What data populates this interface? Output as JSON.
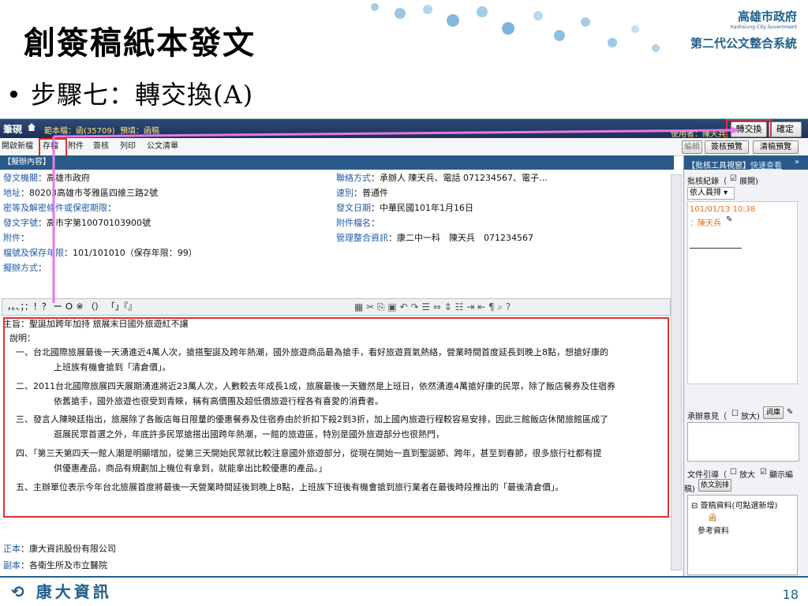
{
  "slide": {
    "title": "創簽稿紙本發文",
    "subtitle": "• 步驟七：轉交換(A)",
    "logo_brand": "高雄市政府",
    "logo_sub": "Kaohsiung City Government",
    "logo_system": "第二代公文整合系統",
    "footer_company": "康大資訊",
    "page_number": "18"
  },
  "app": {
    "topbar": {
      "app_label": "筆硯",
      "doc_no": "範本檔：函(35709)",
      "preset": "預填：函稿",
      "user": "使用者：陳天兵",
      "transfer_button": "轉交換",
      "confirm_button": "確定"
    },
    "toolbar": {
      "items": [
        "開啟新檔",
        "存檔",
        "附件",
        "簽核",
        "列印",
        "公文清單"
      ],
      "edit_button": "編輯",
      "review_preview": "簽核預覽",
      "clean_preview": "清稿預覽"
    },
    "tab_label": "【擬辦內容】",
    "fields_left": [
      {
        "label": "發文機關",
        "value": "：高雄市政府"
      },
      {
        "label": "地址",
        "value": "：80203高雄市苓雅區四維三路2號"
      },
      {
        "label": "密等及解密條件或保密期限",
        "value": "："
      },
      {
        "label": "發文字號",
        "value": "：高市字第10070103900號"
      },
      {
        "label": "附件",
        "value": "："
      },
      {
        "label": "檔號及保存年限",
        "value": "：101/101010（保存年限：99）"
      },
      {
        "label": "擬辦方式",
        "value": "："
      }
    ],
    "fields_right": [
      {
        "label": "聯絡方式",
        "value": "：承辦人 陳天兵、電話 071234567、電子…"
      },
      {
        "label": "速別",
        "value": "：普通件"
      },
      {
        "label": "發文日期",
        "value": "：中華民國101年1月16日"
      },
      {
        "label": "附件檔名",
        "value": "："
      },
      {
        "label": "管理整合資訊",
        "value": "：康二中一科　陳天兵　071234567"
      }
    ],
    "symbol_bar": "，。、；：！？ ー Ｏ ※ （） 「」『』",
    "subject_line": "主旨：聖誕加跨年加持 旅展末日國外旅遊紅不讓",
    "explain_label": "說明：",
    "paragraphs": [
      {
        "first": "一、台北國際旅展最後一天湧進近4萬人次，搶搭聖誕及跨年熱潮，國外旅遊商品最為搶手，看好旅遊買氣熱絡，營業時間首度延長到晚上8點，想搶好康的",
        "second": "上班族有機會搶到「清倉價」。"
      },
      {
        "first": "二、2011台北國際旅展四天展期湧進將近23萬人次，人數較去年成長1成，旅展最後一天雖然是上班日，依然湧進4萬搶好康的民眾，除了飯店餐券及住宿券",
        "second": "依舊搶手，國外旅遊也很受到青睞，稱有高價團及超低價旅遊行程各有喜愛的消費者。"
      },
      {
        "first": "三、發言人陳映廷指出，旅展除了各飯店每日限量的優惠餐券及住宿券由於折扣下殺2到3折，加上國內旅遊行程較容易安排，因此三館飯店休閒旅館區成了",
        "second": "逛展民眾首選之外，年底許多民眾搶搭出國跨年熱潮，一館的旅遊區，特別是國外旅遊部分也很熱門，"
      },
      {
        "first": "四、「第三天第四天一館人潮是明顯增加，從第三天開始民眾就比較注意國外旅遊部分，從現在開始一直到聖誕節、跨年，甚至到春節，很多旅行社都有提",
        "second": "供優惠產品，商品有規劃加上機位有拿到，就能拿出比較優惠的產品。」"
      },
      {
        "first": "五、主辦單位表示今年台北旅展首度將最後一天營業時間延後到晚上8點，上班族下班後有機會搶到旅行業者在最後時段推出的「最後清倉價」。",
        "second": ""
      }
    ],
    "footer_fields": [
      {
        "label": "正本",
        "value": "：康大資訊股份有限公司"
      },
      {
        "label": "副本",
        "value": "：各衛生所及市立醫院"
      }
    ],
    "right_panel": {
      "header": "【批核工具視窗】",
      "quick_view": "快速查看",
      "record_label": "批核紀錄（",
      "record_check": "展開)",
      "dropdown": "依人員排",
      "entry_time": "101/01/13 10:38",
      "entry_user": "：陳天兵",
      "opinion_label": "承辦意見（",
      "opinion_enlarge": "放大)",
      "phrase_button": "詞庫",
      "doc_ref_label": "文件引導（",
      "doc_enlarge": "放大",
      "show_num": "顯示編",
      "show_num2": "稿)",
      "sort_button": "依文別排",
      "tree_root": "簽稿資料(可點選新增)",
      "tree_child": "函",
      "tree_ref": "參考資料"
    }
  }
}
